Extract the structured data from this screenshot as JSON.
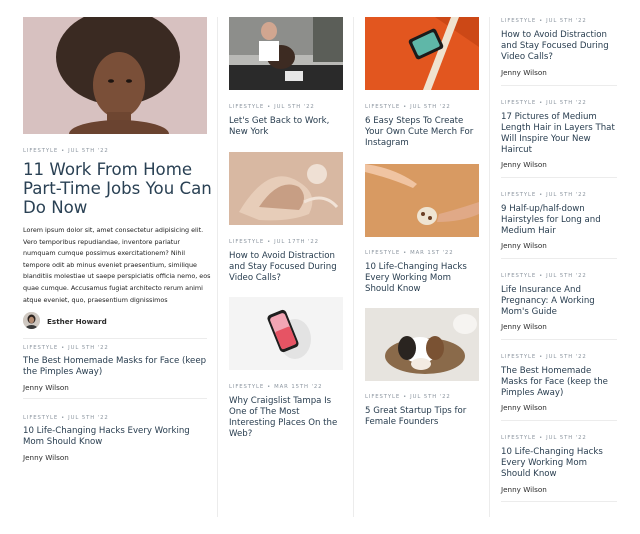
{
  "hero": {
    "meta_category": "LIFESTYLE",
    "meta_date": "JUL 5TH '22",
    "title": "11 Work From Home Part-Time Jobs You Can Do Now",
    "excerpt": "Lorem ipsum dolor sit, amet consectetur adipisicing elit. Vero temporibus repudiandae, inventore pariatur numquam cumque possimus exercitationem? Nihil tempore odit ab minus eveniet praesentium, similique blanditiis molestiae ut saepe perspiciatis officia nemo, eos quae cumque. Accusamus fugiat architecto rerum animi atque eveniet, quo, praesentium dignissimos",
    "author": "Esther Howard"
  },
  "col1_list": [
    {
      "category": "LIFESTYLE",
      "date": "JUL 5TH '22",
      "title": "The Best Homemade Masks for Face (keep the Pimples Away)",
      "author": "Jenny Wilson"
    },
    {
      "category": "LIFESTYLE",
      "date": "JUL 5TH '22",
      "title": "10 Life-Changing Hacks Every Working Mom Should Know",
      "author": "Jenny Wilson"
    }
  ],
  "col2_cards": [
    {
      "category": "LIFESTYLE",
      "date": "JUL 5TH '22",
      "title": "Let's Get Back to Work, New York"
    },
    {
      "category": "LIFESTYLE",
      "date": "JUL 17TH '22",
      "title": "How to Avoid Distraction and Stay Focused During Video Calls?"
    },
    {
      "category": "LIFESTYLE",
      "date": "MAR 15TH '22",
      "title": "Why Craigslist Tampa Is One of The Most Interesting Places On the Web?"
    }
  ],
  "col3_cards": [
    {
      "category": "LIFESTYLE",
      "date": "JUL 5TH '22",
      "title": "6 Easy Steps To Create Your Own Cute Merch For Instagram"
    },
    {
      "category": "LIFESTYLE",
      "date": "MAR 1ST '22",
      "title": "10 Life-Changing Hacks Every Working Mom Should Know"
    },
    {
      "category": "LIFESTYLE",
      "date": "JUL 5TH '22",
      "title": "5 Great Startup Tips for Female Founders"
    }
  ],
  "col4_list": [
    {
      "category": "LIFESTYLE",
      "date": "JUL 5TH '22",
      "title": "How to Avoid Distraction and Stay Focused During Video Calls?",
      "author": "Jenny Wilson"
    },
    {
      "category": "LIFESTYLE",
      "date": "JUL 5TH '22",
      "title": "17 Pictures of Medium Length Hair in Layers That Will Inspire Your New Haircut",
      "author": "Jenny Wilson"
    },
    {
      "category": "LIFESTYLE",
      "date": "JUL 5TH '22",
      "title": "9 Half-up/half-down Hairstyles for Long and Medium Hair",
      "author": "Jenny Wilson"
    },
    {
      "category": "LIFESTYLE",
      "date": "JUL 5TH '22",
      "title": "Life Insurance And Pregnancy: A Working Mom's Guide",
      "author": "Jenny Wilson"
    },
    {
      "category": "LIFESTYLE",
      "date": "JUL 5TH '22",
      "title": "The Best Homemade Masks for Face (keep the Pimples Away)",
      "author": "Jenny Wilson"
    },
    {
      "category": "LIFESTYLE",
      "date": "JUL 5TH '22",
      "title": "10 Life-Changing Hacks Every Working Mom Should Know",
      "author": "Jenny Wilson"
    }
  ],
  "separator": "•"
}
